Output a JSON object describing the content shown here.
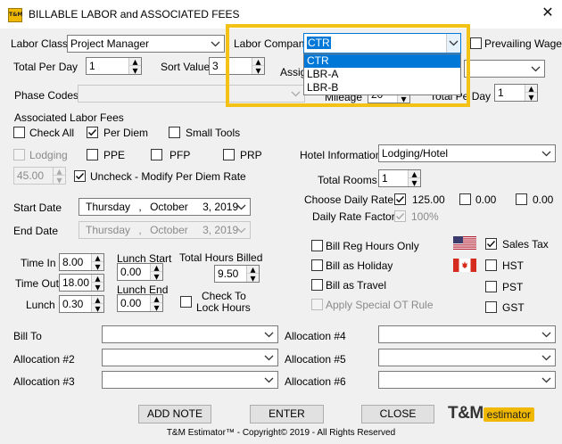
{
  "window": {
    "title": "BILLABLE LABOR and ASSOCIATED FEES",
    "app_icon_text": "T&M"
  },
  "labor_class": {
    "label": "Labor Class",
    "value": "Project Manager"
  },
  "labor_company": {
    "label": "Labor Company",
    "value": "CTR",
    "options": [
      "CTR",
      "LBR-A",
      "LBR-B"
    ],
    "selected_index": 0
  },
  "prevailing_wage": {
    "label": "Prevailing Wage",
    "checked": false
  },
  "total_per_day": {
    "label": "Total Per Day",
    "value": "1"
  },
  "sort_value": {
    "label": "Sort Value",
    "value": "3"
  },
  "assign_label": "Assig",
  "phase_codes": {
    "label": "Phase Codes",
    "value": ""
  },
  "mileage": {
    "label": "Mileage",
    "value": "20"
  },
  "total_per_day2": {
    "label": "Total Pe",
    "label_tail": "Day",
    "value": "1"
  },
  "assoc_fees": {
    "label": "Associated Labor Fees",
    "check_all": {
      "label": "Check All",
      "checked": false
    },
    "per_diem": {
      "label": "Per Diem",
      "checked": true
    },
    "small_tools": {
      "label": "Small Tools",
      "checked": false
    },
    "lodging": {
      "label": "Lodging",
      "checked": false
    },
    "ppe": {
      "label": "PPE",
      "checked": false
    },
    "pfp": {
      "label": "PFP",
      "checked": false
    },
    "prp": {
      "label": "PRP",
      "checked": false
    },
    "per_diem_rate": {
      "value": "45.00"
    },
    "uncheck_modify": {
      "label": "Uncheck - Modify Per Diem Rate",
      "checked": true
    }
  },
  "hotel": {
    "info_label": "Hotel Information",
    "info_value": "Lodging/Hotel",
    "total_rooms_label": "Total Rooms",
    "total_rooms_value": "1",
    "choose_rate_label": "Choose Daily Rate",
    "rates": [
      {
        "value": "125.00",
        "checked": true
      },
      {
        "value": "0.00",
        "checked": false
      },
      {
        "value": "0.00",
        "checked": false
      }
    ],
    "daily_rate_factor_label": "Daily Rate Factor",
    "daily_rate_factor_value": "100%",
    "daily_rate_factor_checked": true
  },
  "start_date": {
    "label": "Start Date",
    "weekday": "Thursday",
    "sep": ",",
    "month": "October",
    "day": "3, 2019"
  },
  "end_date": {
    "label": "End Date",
    "weekday": "Thursday",
    "sep": ",",
    "month": "October",
    "day": "3, 2019"
  },
  "time": {
    "time_in_label": "Time In",
    "time_in": "8.00",
    "time_out_label": "Time Out",
    "time_out": "18.00",
    "lunch_label": "Lunch",
    "lunch": "0.30",
    "lunch_start_label": "Lunch Start",
    "lunch_start": "0.00",
    "lunch_end_label": "Lunch End",
    "lunch_end": "0.00",
    "total_hours_label": "Total Hours Billed",
    "total_hours": "9.50",
    "check_to_lock_label_1": "Check To",
    "check_to_lock_label_2": "Lock Hours",
    "check_to_lock_checked": false
  },
  "billing": {
    "bill_reg": {
      "label": "Bill Reg Hours Only",
      "checked": false
    },
    "bill_holiday": {
      "label": "Bill as Holiday",
      "checked": false
    },
    "bill_travel": {
      "label": "Bill as Travel",
      "checked": false
    },
    "apply_ot": {
      "label": "Apply Special OT Rule",
      "checked": false
    }
  },
  "taxes": {
    "sales_tax": {
      "label": "Sales Tax",
      "checked": true
    },
    "hst": {
      "label": "HST",
      "checked": false
    },
    "pst": {
      "label": "PST",
      "checked": false
    },
    "gst": {
      "label": "GST",
      "checked": false
    }
  },
  "allocations": {
    "bill_to": "Bill To",
    "a2": "Allocation #2",
    "a3": "Allocation #3",
    "a4": "Allocation #4",
    "a5": "Allocation #5",
    "a6": "Allocation #6"
  },
  "buttons": {
    "add_note": "ADD NOTE",
    "enter": "ENTER",
    "close": "CLOSE"
  },
  "logo": {
    "tm": "T&M",
    "estimator": "estimator"
  },
  "footer": "T&M Estimator™ - Copyright© 2019 - All Rights Reserved",
  "colors": {
    "highlight": "#f3c215",
    "selection": "#0078d7",
    "brand": "#f0b800"
  },
  "icons": [
    "us-flag-icon",
    "canada-flag-icon",
    "chevron-down-icon",
    "checkmark-icon",
    "close-icon"
  ]
}
